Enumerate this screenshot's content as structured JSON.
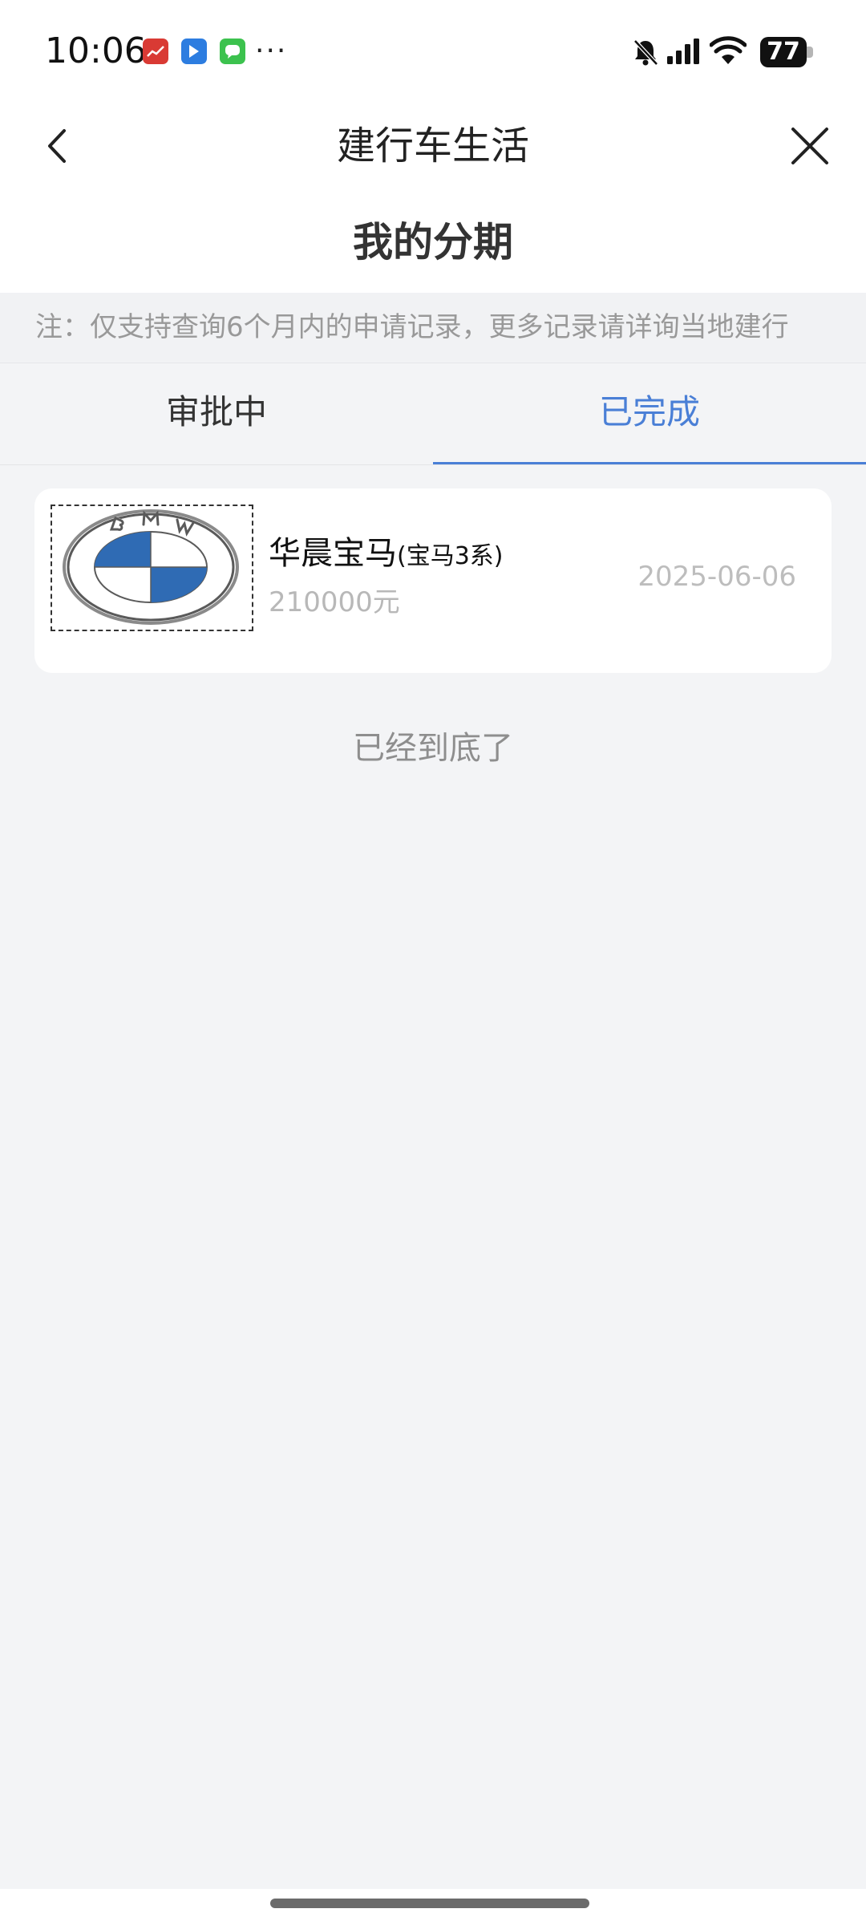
{
  "status_bar": {
    "time": "10:06",
    "more": "···",
    "battery": "77",
    "app_icons": [
      "stocks-app-icon",
      "bluemap-app-icon",
      "messages-app-icon"
    ]
  },
  "nav": {
    "title": "建行车生活"
  },
  "page": {
    "title": "我的分期",
    "notice": "注：仅支持查询6个月内的申请记录，更多记录请详询当地建行"
  },
  "tabs": [
    {
      "label": "审批中",
      "active": false
    },
    {
      "label": "已完成",
      "active": true
    }
  ],
  "records": [
    {
      "dealer": "华晨宝马",
      "model": "(宝马3系)",
      "amount": "210000元",
      "date": "2025-06-06",
      "logo": "bmw-logo",
      "logo_letters": "BMW"
    }
  ],
  "end_text": "已经到底了",
  "colors": {
    "accent": "#4a7fd6",
    "background": "#f3f4f6",
    "bmw_blue": "#2f6bb4"
  }
}
